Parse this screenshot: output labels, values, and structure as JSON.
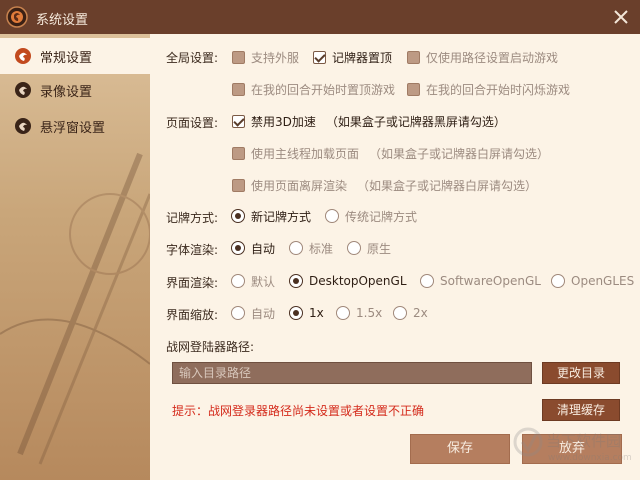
{
  "window": {
    "title": "系统设置",
    "close_icon": "close-icon",
    "app_icon": "shield-logo-icon"
  },
  "sidebar": {
    "items": [
      {
        "label": "常规设置",
        "active": true
      },
      {
        "label": "录像设置",
        "active": false
      },
      {
        "label": "悬浮窗设置",
        "active": false
      }
    ]
  },
  "global": {
    "label": "全局设置:",
    "opt_foreign": "支持外服",
    "opt_tracker_top": "记牌器置顶",
    "opt_path_launch": "仅使用路径设置启动游戏",
    "opt_turn_top": "在我的回合开始时置顶游戏",
    "opt_turn_flash": "在我的回合开始时闪烁游戏"
  },
  "page": {
    "label": "页面设置:",
    "opt_disable_3d": "禁用3D加速",
    "opt_disable_3d_note": "（如果盒子或记牌器黑屏请勾选）",
    "opt_main_thread": "使用主线程加载页面",
    "opt_main_thread_note": "（如果盒子或记牌器白屏请勾选）",
    "opt_offscreen": "使用页面离屏渲染",
    "opt_offscreen_note": "（如果盒子或记牌器白屏请勾选）"
  },
  "tracker_mode": {
    "label": "记牌方式:",
    "options": [
      "新记牌方式",
      "传统记牌方式"
    ],
    "selected": "新记牌方式"
  },
  "font_render": {
    "label": "字体渲染:",
    "options": [
      "自动",
      "标准",
      "原生"
    ],
    "selected": "自动"
  },
  "ui_render": {
    "label": "界面渲染:",
    "options": [
      "默认",
      "DesktopOpenGL",
      "SoftwareOpenGL",
      "OpenGLES"
    ],
    "selected": "DesktopOpenGL"
  },
  "ui_scale": {
    "label": "界面缩放:",
    "options": [
      "自动",
      "1x",
      "1.5x",
      "2x"
    ],
    "selected": "1x"
  },
  "launcher": {
    "label": "战网登陆器路径:",
    "placeholder": "输入目录路径",
    "value": "",
    "change_dir": "更改目录",
    "clear_cache": "清理缓存",
    "hint": "提示：战网登录器路径尚未设置或者设置不正确"
  },
  "footer": {
    "save": "保存",
    "cancel": "放弃"
  },
  "watermark": {
    "text": "当下软件园",
    "sub": "www.downxia.com"
  },
  "colors": {
    "titlebar": "#6a3f2b",
    "accent": "#8a4b2e",
    "hint": "#d42a1b"
  }
}
